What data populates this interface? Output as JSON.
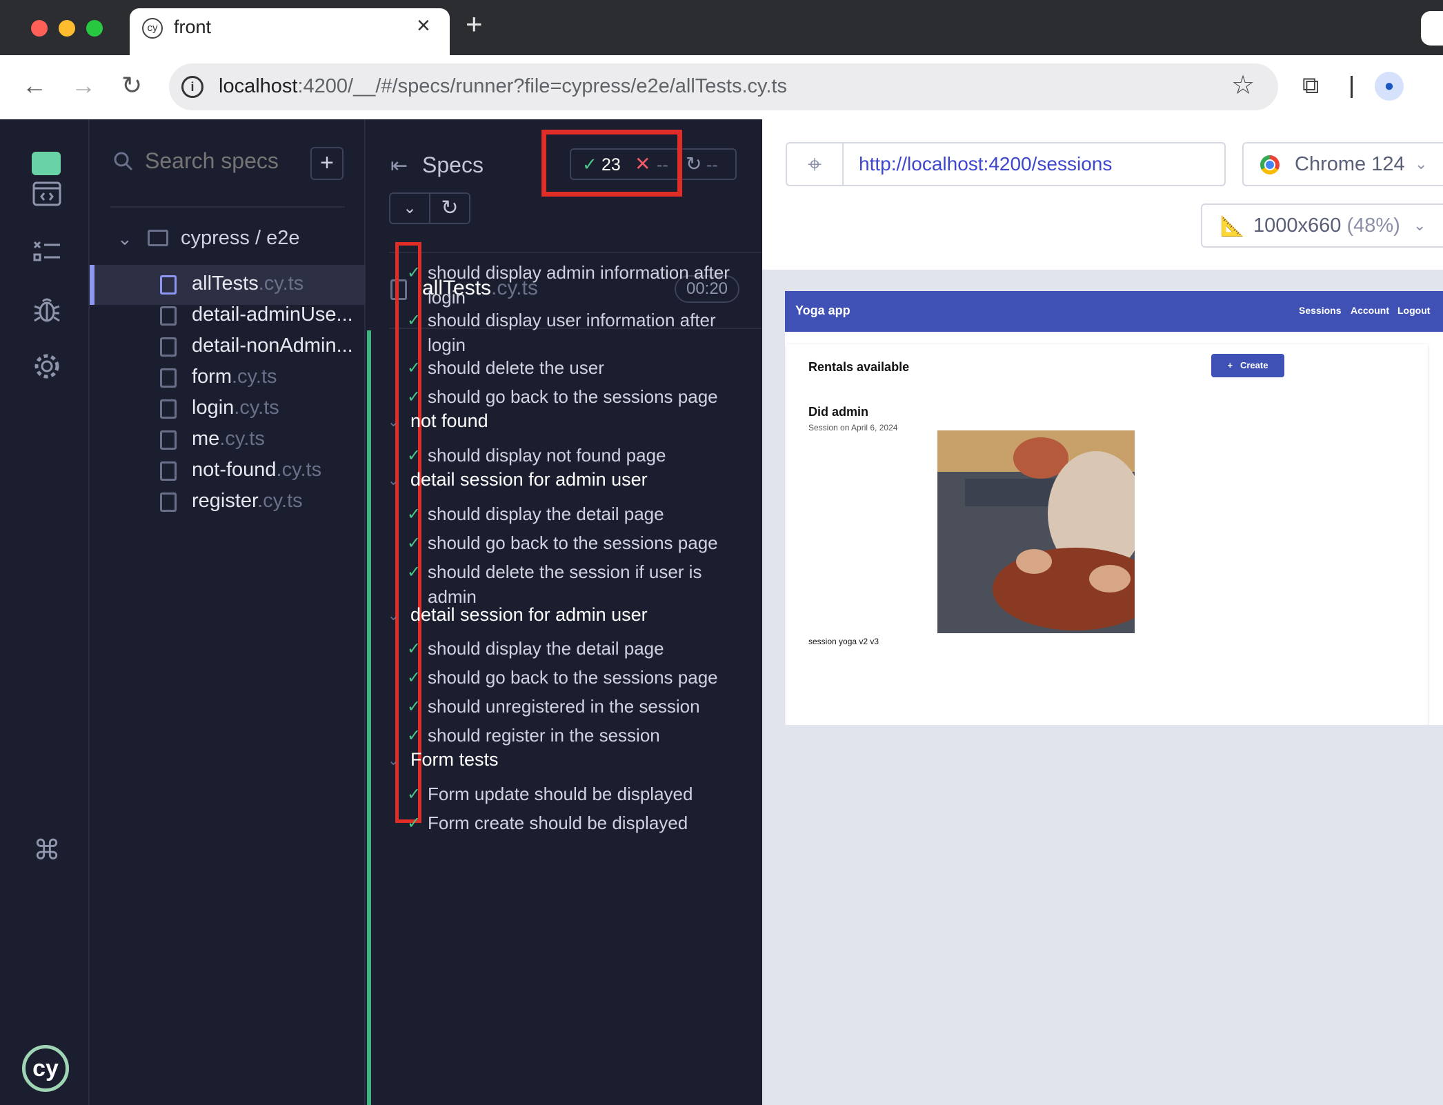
{
  "browser": {
    "tab_title": "front",
    "tab_favicon": "cy",
    "url_host": "localhost",
    "url_rest": ":4200/__/#/specs/runner?file=cypress/e2e/allTests.cy.ts"
  },
  "sidebar": {
    "search_placeholder": "Search specs",
    "folder": "cypress / e2e",
    "specs": [
      {
        "name": "allTests",
        "ext": ".cy.ts"
      },
      {
        "name": "detail-adminUse...",
        "ext": ""
      },
      {
        "name": "detail-nonAdmin...",
        "ext": ""
      },
      {
        "name": "form",
        "ext": ".cy.ts"
      },
      {
        "name": "login",
        "ext": ".cy.ts"
      },
      {
        "name": "me",
        "ext": ".cy.ts"
      },
      {
        "name": "not-found",
        "ext": ".cy.ts"
      },
      {
        "name": "register",
        "ext": ".cy.ts"
      }
    ]
  },
  "reporter": {
    "header": "Specs",
    "passed": "23",
    "failed": "--",
    "pending": "--",
    "file_name": "allTests",
    "file_ext": ".cy.ts",
    "duration": "00:20",
    "rows": [
      {
        "kind": "test",
        "title": "should display admin information after login"
      },
      {
        "kind": "test",
        "title": "should display user information after login"
      },
      {
        "kind": "test",
        "title": "should delete the user"
      },
      {
        "kind": "test",
        "title": "should go back to the sessions page"
      },
      {
        "kind": "suite",
        "title": "not found"
      },
      {
        "kind": "test",
        "title": "should display not found page"
      },
      {
        "kind": "suite",
        "title": "detail session for admin user"
      },
      {
        "kind": "test",
        "title": "should display the detail page"
      },
      {
        "kind": "test",
        "title": "should go back to the sessions page"
      },
      {
        "kind": "test",
        "title": "should delete the session if user is admin"
      },
      {
        "kind": "suite",
        "title": "detail session for admin user"
      },
      {
        "kind": "test",
        "title": "should display the detail page"
      },
      {
        "kind": "test",
        "title": "should go back to the sessions page"
      },
      {
        "kind": "test",
        "title": "should unregistered in the session"
      },
      {
        "kind": "test",
        "title": "should register in the session"
      },
      {
        "kind": "suite",
        "title": "Form tests"
      },
      {
        "kind": "test",
        "title": "Form update should be displayed"
      },
      {
        "kind": "test",
        "title": "Form create should be displayed"
      }
    ]
  },
  "aut": {
    "url": "http://localhost:4200/sessions",
    "browser": "Chrome 124",
    "viewport": "1000x660",
    "viewport_scale": "(48%)"
  },
  "app": {
    "title": "Yoga app",
    "nav": [
      "Sessions",
      "Account",
      "Logout"
    ],
    "rentals_title": "Rentals available",
    "create_label": "Create",
    "session_name": "Did admin",
    "session_date": "Session on April 6, 2024",
    "session_desc": "session yoga v2 v3"
  },
  "colors": {
    "pass": "#4cc48a",
    "fail": "#ef5a66",
    "highlight": "#e02d28",
    "app_primary": "#3f51b5"
  }
}
